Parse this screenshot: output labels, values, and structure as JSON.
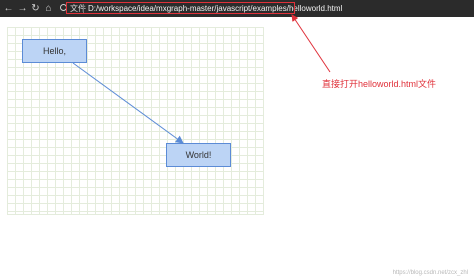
{
  "browser": {
    "nav": {
      "back_glyph": "←",
      "forward_glyph": "→",
      "reload_glyph": "↻",
      "home_glyph": "⌂"
    },
    "icons": [
      "arrow-left-icon",
      "arrow-right-icon",
      "reload-icon",
      "home-icon",
      "info-icon"
    ],
    "file_label": "文件",
    "url": "D:/workspace/idea/mxgraph-master/javascript/examples/helloworld.html"
  },
  "graph": {
    "nodes": [
      {
        "id": "hello",
        "label": "Hello,"
      },
      {
        "id": "world",
        "label": "World!"
      }
    ],
    "edges": [
      {
        "source": "hello",
        "target": "world"
      }
    ]
  },
  "annotation": {
    "text": "直接打开helloworld.html文件"
  },
  "watermark": "https://blog.csdn.net/zcx_zhl",
  "colors": {
    "highlight": "#e0313a",
    "node_fill": "#bcd4f5",
    "node_border": "#5b8bd6",
    "edge": "#5b8bd6",
    "grid": "#e4ecdc"
  }
}
